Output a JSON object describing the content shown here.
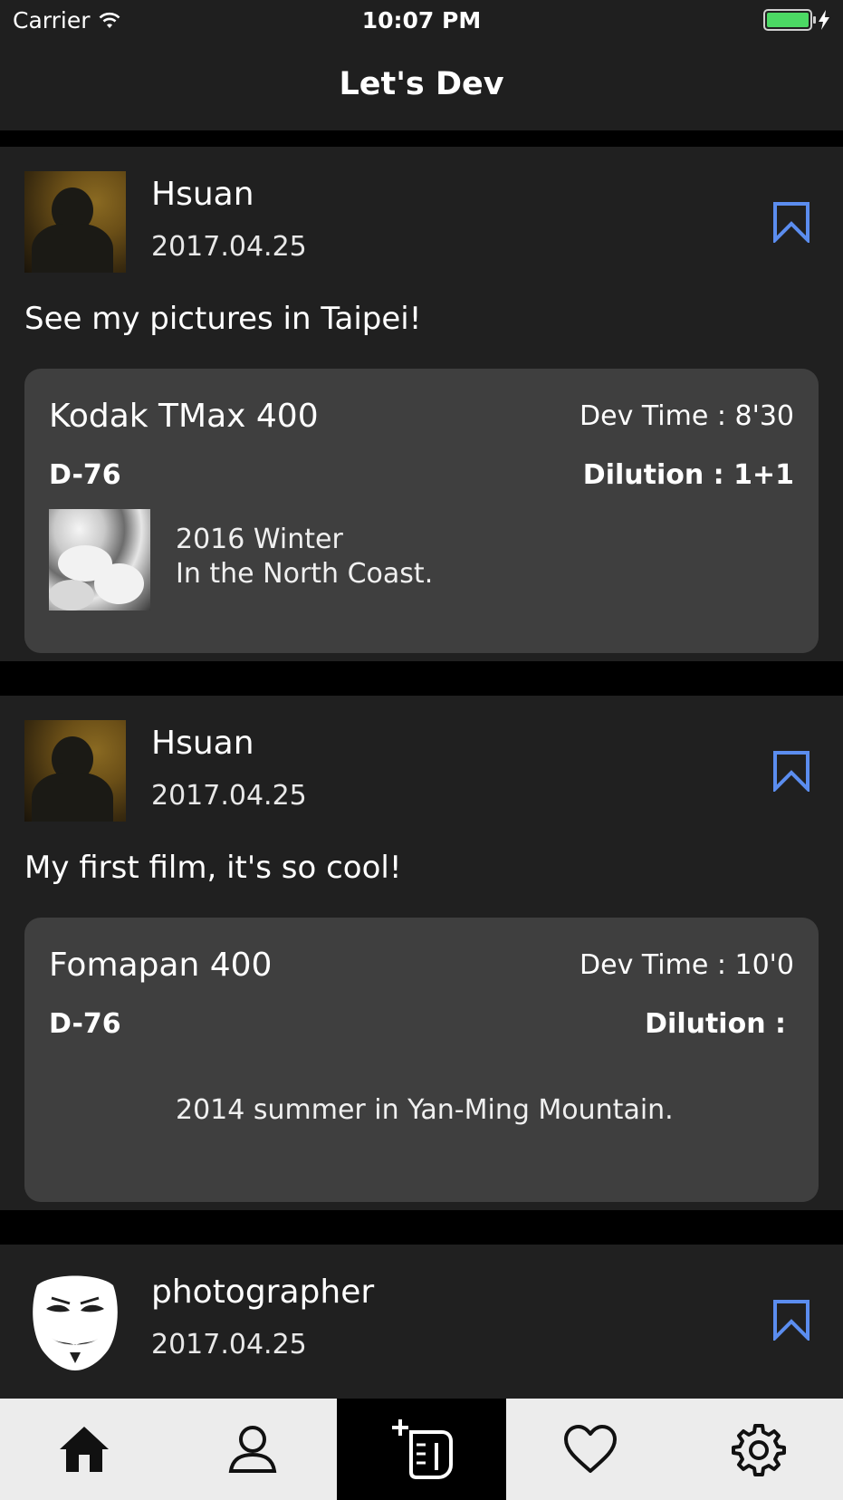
{
  "status_bar": {
    "carrier": "Carrier",
    "time": "10:07 PM",
    "battery_level": 1.0
  },
  "nav": {
    "title": "Let's Dev"
  },
  "colors": {
    "background": "#000000",
    "post_background": "#202020",
    "card_background": "#3f3f3f",
    "bookmark_accent": "#5b8def",
    "battery_green": "#4cd964",
    "tab_bar_background": "#ececec",
    "tab_selected_background": "#000000"
  },
  "posts": [
    {
      "username": "Hsuan",
      "date": "2017.04.25",
      "caption": "See my pictures in Taipei!",
      "avatar": "photo-avatar",
      "bookmark_icon": "bookmark-icon",
      "card": {
        "film": "Kodak TMax 400",
        "dev_time": "Dev Time : 8'30",
        "developer": "D-76",
        "dilution": "Dilution : 1+1",
        "description_lines": [
          "2016 Winter",
          "In the North Coast."
        ],
        "has_thumbnail": true
      }
    },
    {
      "username": "Hsuan",
      "date": "2017.04.25",
      "caption": "My first film, it's so cool!",
      "avatar": "photo-avatar",
      "bookmark_icon": "bookmark-icon",
      "card": {
        "film": "Fomapan 400",
        "dev_time": "Dev Time : 10'0",
        "developer": "D-76",
        "dilution": "Dilution :",
        "description": "2014 summer in Yan-Ming Mountain.",
        "has_thumbnail": false
      }
    },
    {
      "username": "photographer",
      "date": "2017.04.25",
      "avatar": "mask-avatar",
      "bookmark_icon": "bookmark-icon"
    }
  ],
  "tab_bar": {
    "items": [
      {
        "icon": "home-icon",
        "selected": false
      },
      {
        "icon": "profile-icon",
        "selected": false
      },
      {
        "icon": "add-record-icon",
        "selected": true
      },
      {
        "icon": "heart-icon",
        "selected": false
      },
      {
        "icon": "settings-gear-icon",
        "selected": false
      }
    ]
  }
}
